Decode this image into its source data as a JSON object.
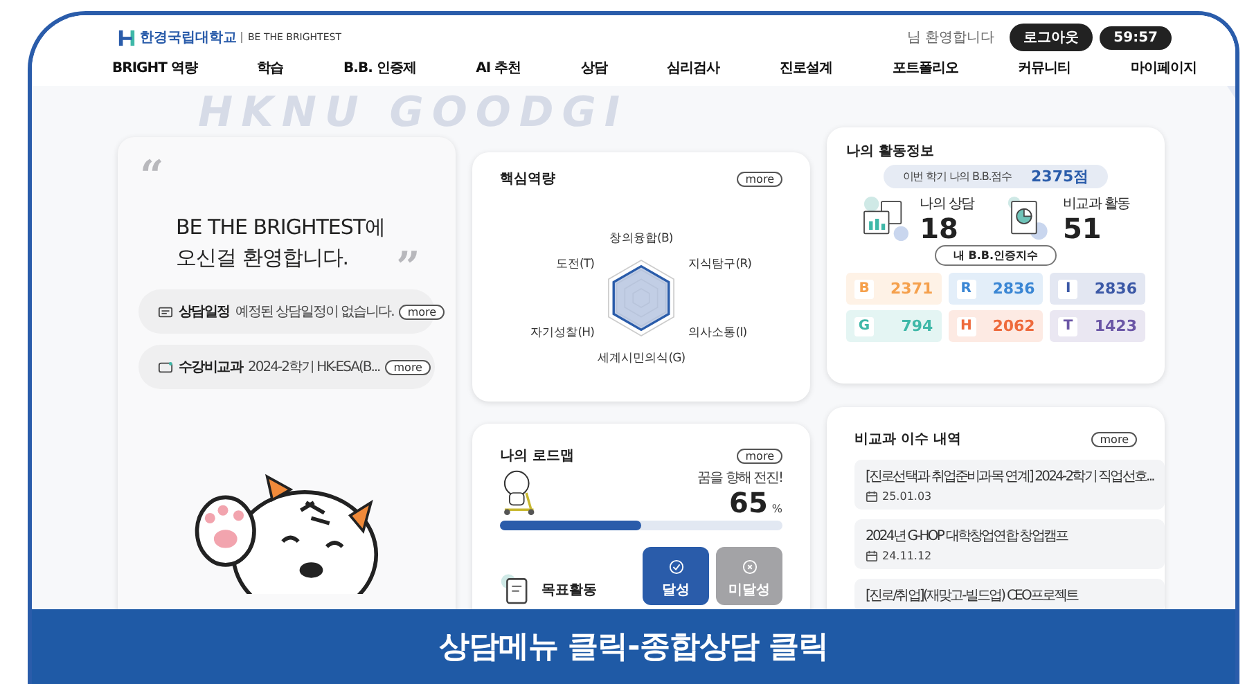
{
  "header": {
    "logo_text": "한경국립대학교",
    "logo_tagline": "BE THE BRIGHTEST",
    "greeting": "님 환영합니다",
    "logout_button": "로그아웃",
    "session_timer": "59:57"
  },
  "nav": [
    "BRIGHT 역량",
    "학습",
    "B.B. 인증제",
    "AI 추천",
    "상담",
    "심리검사",
    "진로설계",
    "포트폴리오",
    "커뮤니티",
    "마이페이지"
  ],
  "background_text": "HKNU GOODGI",
  "welcome": {
    "quote_open": "“",
    "quote_close": "”",
    "title_lines": [
      "BE THE BRIGHTEST에",
      "오신걸 환영합니다."
    ],
    "items": [
      {
        "kind": "schedule",
        "label": "상담일정",
        "text": "예정된 상담일정이 없습니다.",
        "more": "more"
      },
      {
        "kind": "course",
        "label": "수강비교과",
        "text": "2024-2학기 HK-ESA(B...",
        "more": "more"
      }
    ]
  },
  "competency": {
    "title": "핵심역량",
    "more": "more",
    "axes": [
      "창의융합(B)",
      "지식탐구(R)",
      "의사소통(I)",
      "세계시민의식(G)",
      "자기성찰(H)",
      "도전(T)"
    ]
  },
  "roadmap": {
    "title": "나의 로드맵",
    "more": "more",
    "caption": "꿈을 향해 전진!",
    "percent": "65",
    "unit": "%",
    "level": 0.5,
    "goal_label": "목표활동",
    "buttons": [
      {
        "kind": "achieved",
        "label": "달성",
        "selected": true
      },
      {
        "kind": "not_achieved",
        "label": "미달성",
        "selected": false
      }
    ]
  },
  "activity": {
    "title": "나의 활동정보",
    "score_label": "이번 학기 나의 B.B.점수",
    "score": "2375점",
    "stats": [
      {
        "kind": "counsel",
        "label": "나의 상담",
        "value": "18"
      },
      {
        "kind": "extracurricular",
        "label": "비교과 활동",
        "value": "51"
      }
    ],
    "index_label": "내 B.B.인증지수",
    "indices": [
      {
        "letter": "B",
        "value": "2371",
        "color": "#f5a04c"
      },
      {
        "letter": "R",
        "value": "2836",
        "color": "#3a86d4"
      },
      {
        "letter": "I",
        "value": "2836",
        "color": "#3b58a6"
      },
      {
        "letter": "G",
        "value": "794",
        "color": "#3fb8a8"
      },
      {
        "letter": "H",
        "value": "2062",
        "color": "#ee6a3c"
      },
      {
        "letter": "T",
        "value": "1423",
        "color": "#6b56a6"
      }
    ]
  },
  "history": {
    "title": "비교과 이수 내역",
    "more": "more",
    "items": [
      {
        "title": "[진로선택과 취업준비과목 연계] 2024-2학기 직업선호...",
        "date": "25.01.03"
      },
      {
        "title": "2024년 G-HOP 대학창업연합 창업캠프",
        "date": "24.11.12"
      },
      {
        "title": "[진로/취업](재맞고-빌드업) CEO프로젝트"
      }
    ]
  },
  "banner": "상담메뉴 클릭-종합상담 클릭"
}
